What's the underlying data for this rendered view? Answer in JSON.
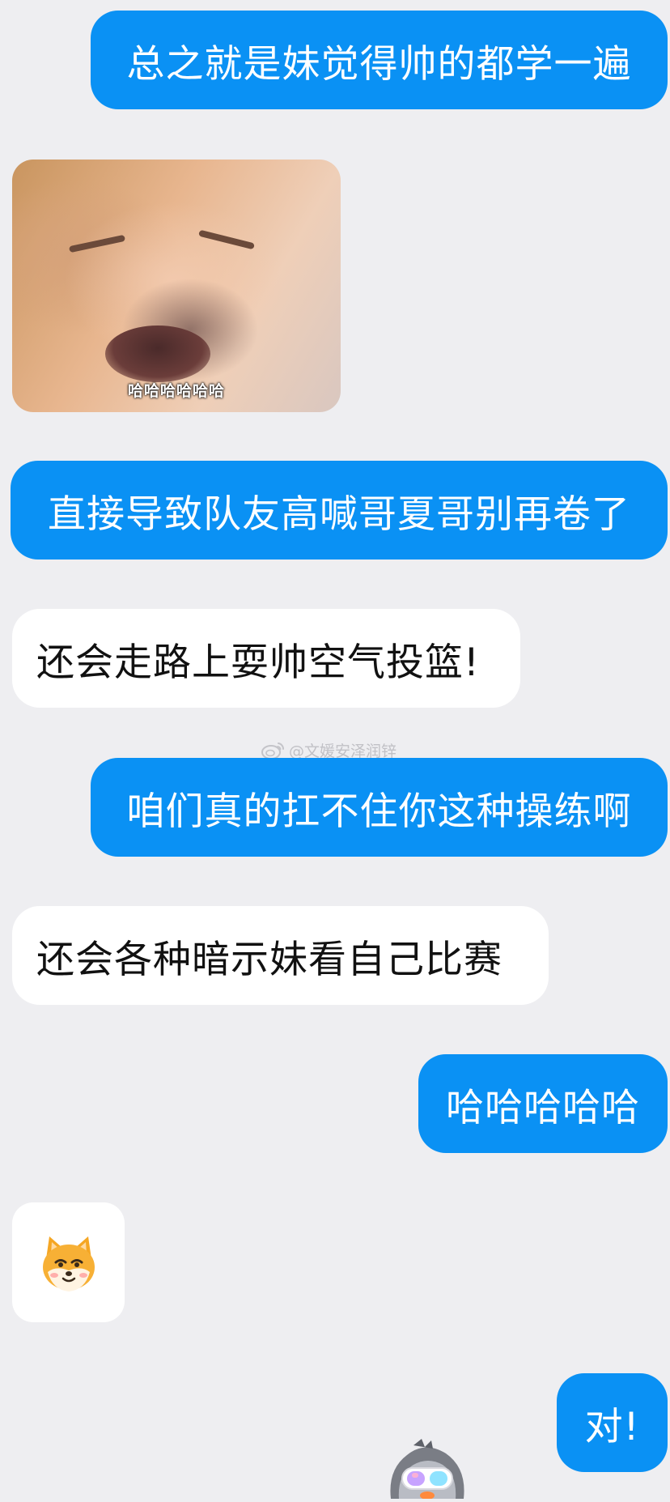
{
  "chat": {
    "messages": [
      {
        "side": "outgoing",
        "text": "总之就是妹觉得帅的都学一遍"
      },
      {
        "side": "incoming",
        "image_caption": "哈哈哈哈哈哈"
      },
      {
        "side": "outgoing",
        "text": "直接导致队友高喊哥夏哥别再卷了"
      },
      {
        "side": "incoming",
        "text": "还会走路上耍帅空气投篮!"
      },
      {
        "side": "outgoing",
        "text": "咱们真的扛不住你这种操练啊"
      },
      {
        "side": "incoming",
        "text": "还会各种暗示妹看自己比赛"
      },
      {
        "side": "outgoing",
        "text": "哈哈哈哈哈"
      },
      {
        "side": "incoming",
        "sticker": "shiba-dog-sticker-icon"
      },
      {
        "side": "outgoing",
        "text": "对!"
      }
    ]
  },
  "watermark": {
    "text": "@文媛安泽润锌",
    "icon": "weibo-icon"
  },
  "colors": {
    "background": "#eeeef1",
    "outgoing_bubble": "#0a91f4",
    "incoming_bubble": "#ffffff"
  }
}
